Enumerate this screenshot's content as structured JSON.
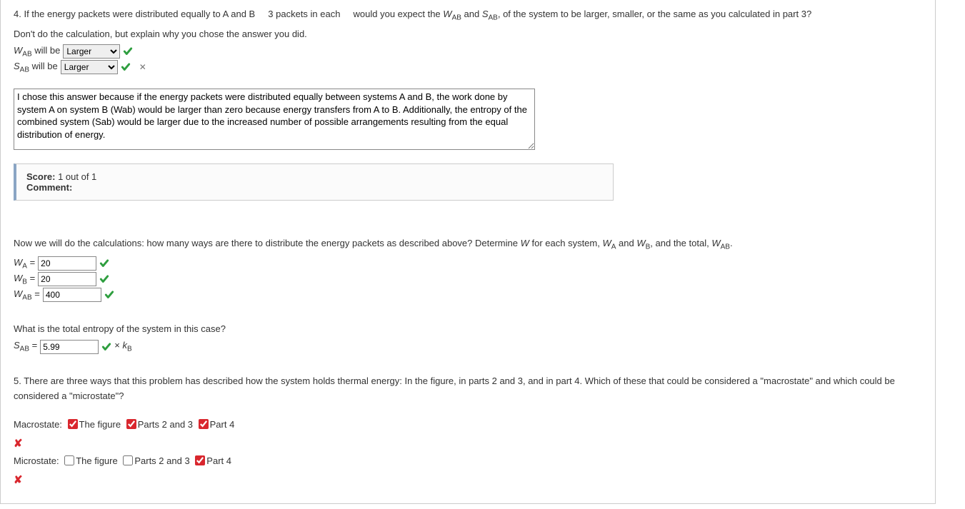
{
  "q4": {
    "prompt_a": "4. If the energy packets were distributed equally to A and B",
    "prompt_b": "3 packets in each",
    "prompt_c": "would you expect the ",
    "prompt_d": " and ",
    "prompt_e": ", of the system to be larger, smaller, or the same as you calculated in part 3?",
    "prompt_line2": "Don't do the calculation, but explain why you chose the answer you did.",
    "wab_label_a": "W",
    "wab_label_b": "AB",
    "wab_text": " will be ",
    "wab_value": "Larger",
    "sab_label_a": "S",
    "sab_label_b": "AB",
    "sab_text": " will be ",
    "sab_value": "Larger",
    "textarea_value": "I chose this answer because if the energy packets were distributed equally between systems A and B, the work done by system A on system B (Wab) would be larger than zero because energy transfers from A to B. Additionally, the entropy of the combined system (Sab) would be larger due to the increased number of possible arrangements resulting from the equal distribution of energy."
  },
  "feedback": {
    "score_label": "Score:",
    "score_value": " 1 out of 1",
    "comment_label": "Comment:"
  },
  "calc": {
    "intro_a": "Now we will do the calculations: how many ways are there to distribute the energy packets as described above? Determine ",
    "intro_b": " for each system, ",
    "intro_c": " and ",
    "intro_d": ", and the total, ",
    "W": "W",
    "WA_a": "W",
    "WA_b": "A",
    "WB_a": "W",
    "WB_b": "B",
    "WAB_a": "W",
    "WAB_b": "AB",
    "eq": " = ",
    "wa_val": "20",
    "wb_val": "20",
    "wab_val": "400"
  },
  "entropy": {
    "question": "What is the total entropy of the system in this case?",
    "S_a": "S",
    "S_b": "AB",
    "eq": " = ",
    "val": "5.99",
    "unit_pre": " × ",
    "unit_a": "k",
    "unit_b": "B"
  },
  "q5": {
    "text": "5. There are three ways that this problem has described how the system holds thermal energy: In the figure, in parts 2 and 3, and in part 4. Which of these that could be considered a \"macrostate\" and which could be considered a \"microstate\"?",
    "macro_label": "Macrostate: ",
    "micro_label": "Microstate: ",
    "opt1": "The figure ",
    "opt2": "Parts 2 and 3 ",
    "opt3": "Part 4",
    "x": "✘"
  }
}
